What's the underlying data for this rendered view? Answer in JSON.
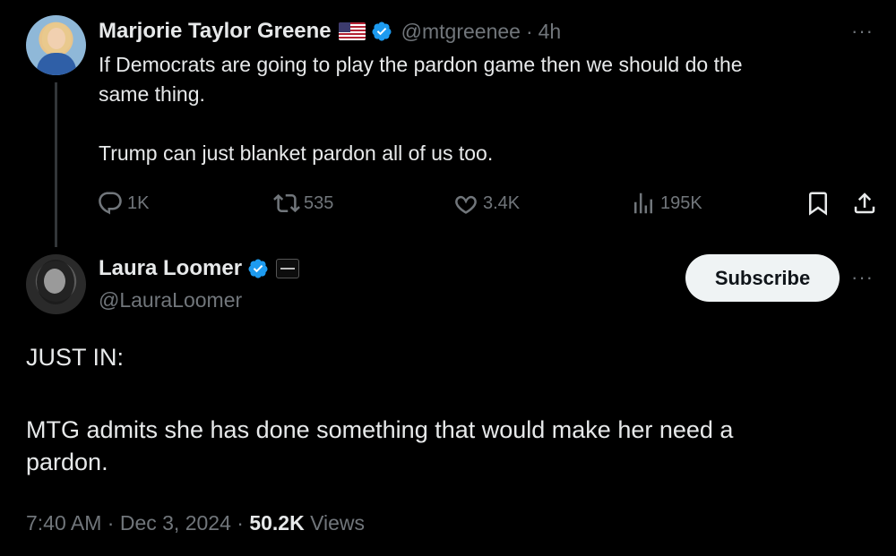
{
  "parent_tweet": {
    "author_name": "Marjorie Taylor Greene",
    "handle": "@mtgreenee",
    "separator": "·",
    "time_ago": "4h",
    "text_lines": [
      "If Democrats are going to play the pardon game then we should do the",
      "same thing.",
      "",
      "Trump can just blanket pardon all of us too."
    ],
    "actions": {
      "replies": "1K",
      "reposts": "535",
      "likes": "3.4K",
      "views": "195K"
    },
    "more": "···"
  },
  "main_tweet": {
    "author_name": "Laura Loomer",
    "handle": "@LauraLoomer",
    "subscribe_label": "Subscribe",
    "more": "···",
    "text_lines": [
      "JUST IN:",
      "",
      "MTG admits she has done something that would make her need a",
      "pardon."
    ],
    "meta": {
      "time": "7:40 AM",
      "sep1": "·",
      "date": "Dec 3, 2024",
      "sep2": "·",
      "views_count": "50.2K",
      "views_label": "Views"
    }
  },
  "icons": {
    "verified": "verified-badge-icon",
    "flag": "us-flag-icon",
    "reply": "reply-icon",
    "repost": "repost-icon",
    "like": "heart-icon",
    "views": "analytics-icon",
    "bookmark": "bookmark-icon",
    "share": "share-icon"
  },
  "colors": {
    "background": "#000000",
    "text": "#e7e9ea",
    "muted": "#71767b",
    "verified_blue": "#1d9bf0",
    "subscribe_bg": "#eff3f4"
  }
}
